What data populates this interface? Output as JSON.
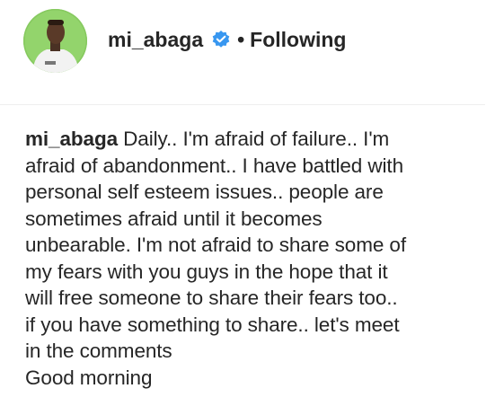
{
  "post": {
    "username": "mi_abaga",
    "separator": "•",
    "follow_status": "Following",
    "verified_icon": "verified-badge-icon",
    "avatar_icon": "profile-avatar",
    "accent_color": "#3897f0"
  },
  "caption": {
    "username": "mi_abaga",
    "lines": [
      "Daily.. I'm afraid of failure.. I'm",
      "afraid of abandonment.. I have battled with",
      "personal self esteem issues.. people are",
      "sometimes afraid until it becomes",
      "unbearable. I'm not afraid to share some of",
      "my fears with you guys in the hope that it",
      "will free someone to share their fears too..",
      "if you have something to share.. let's meet",
      "in the comments",
      "Good morning"
    ]
  }
}
